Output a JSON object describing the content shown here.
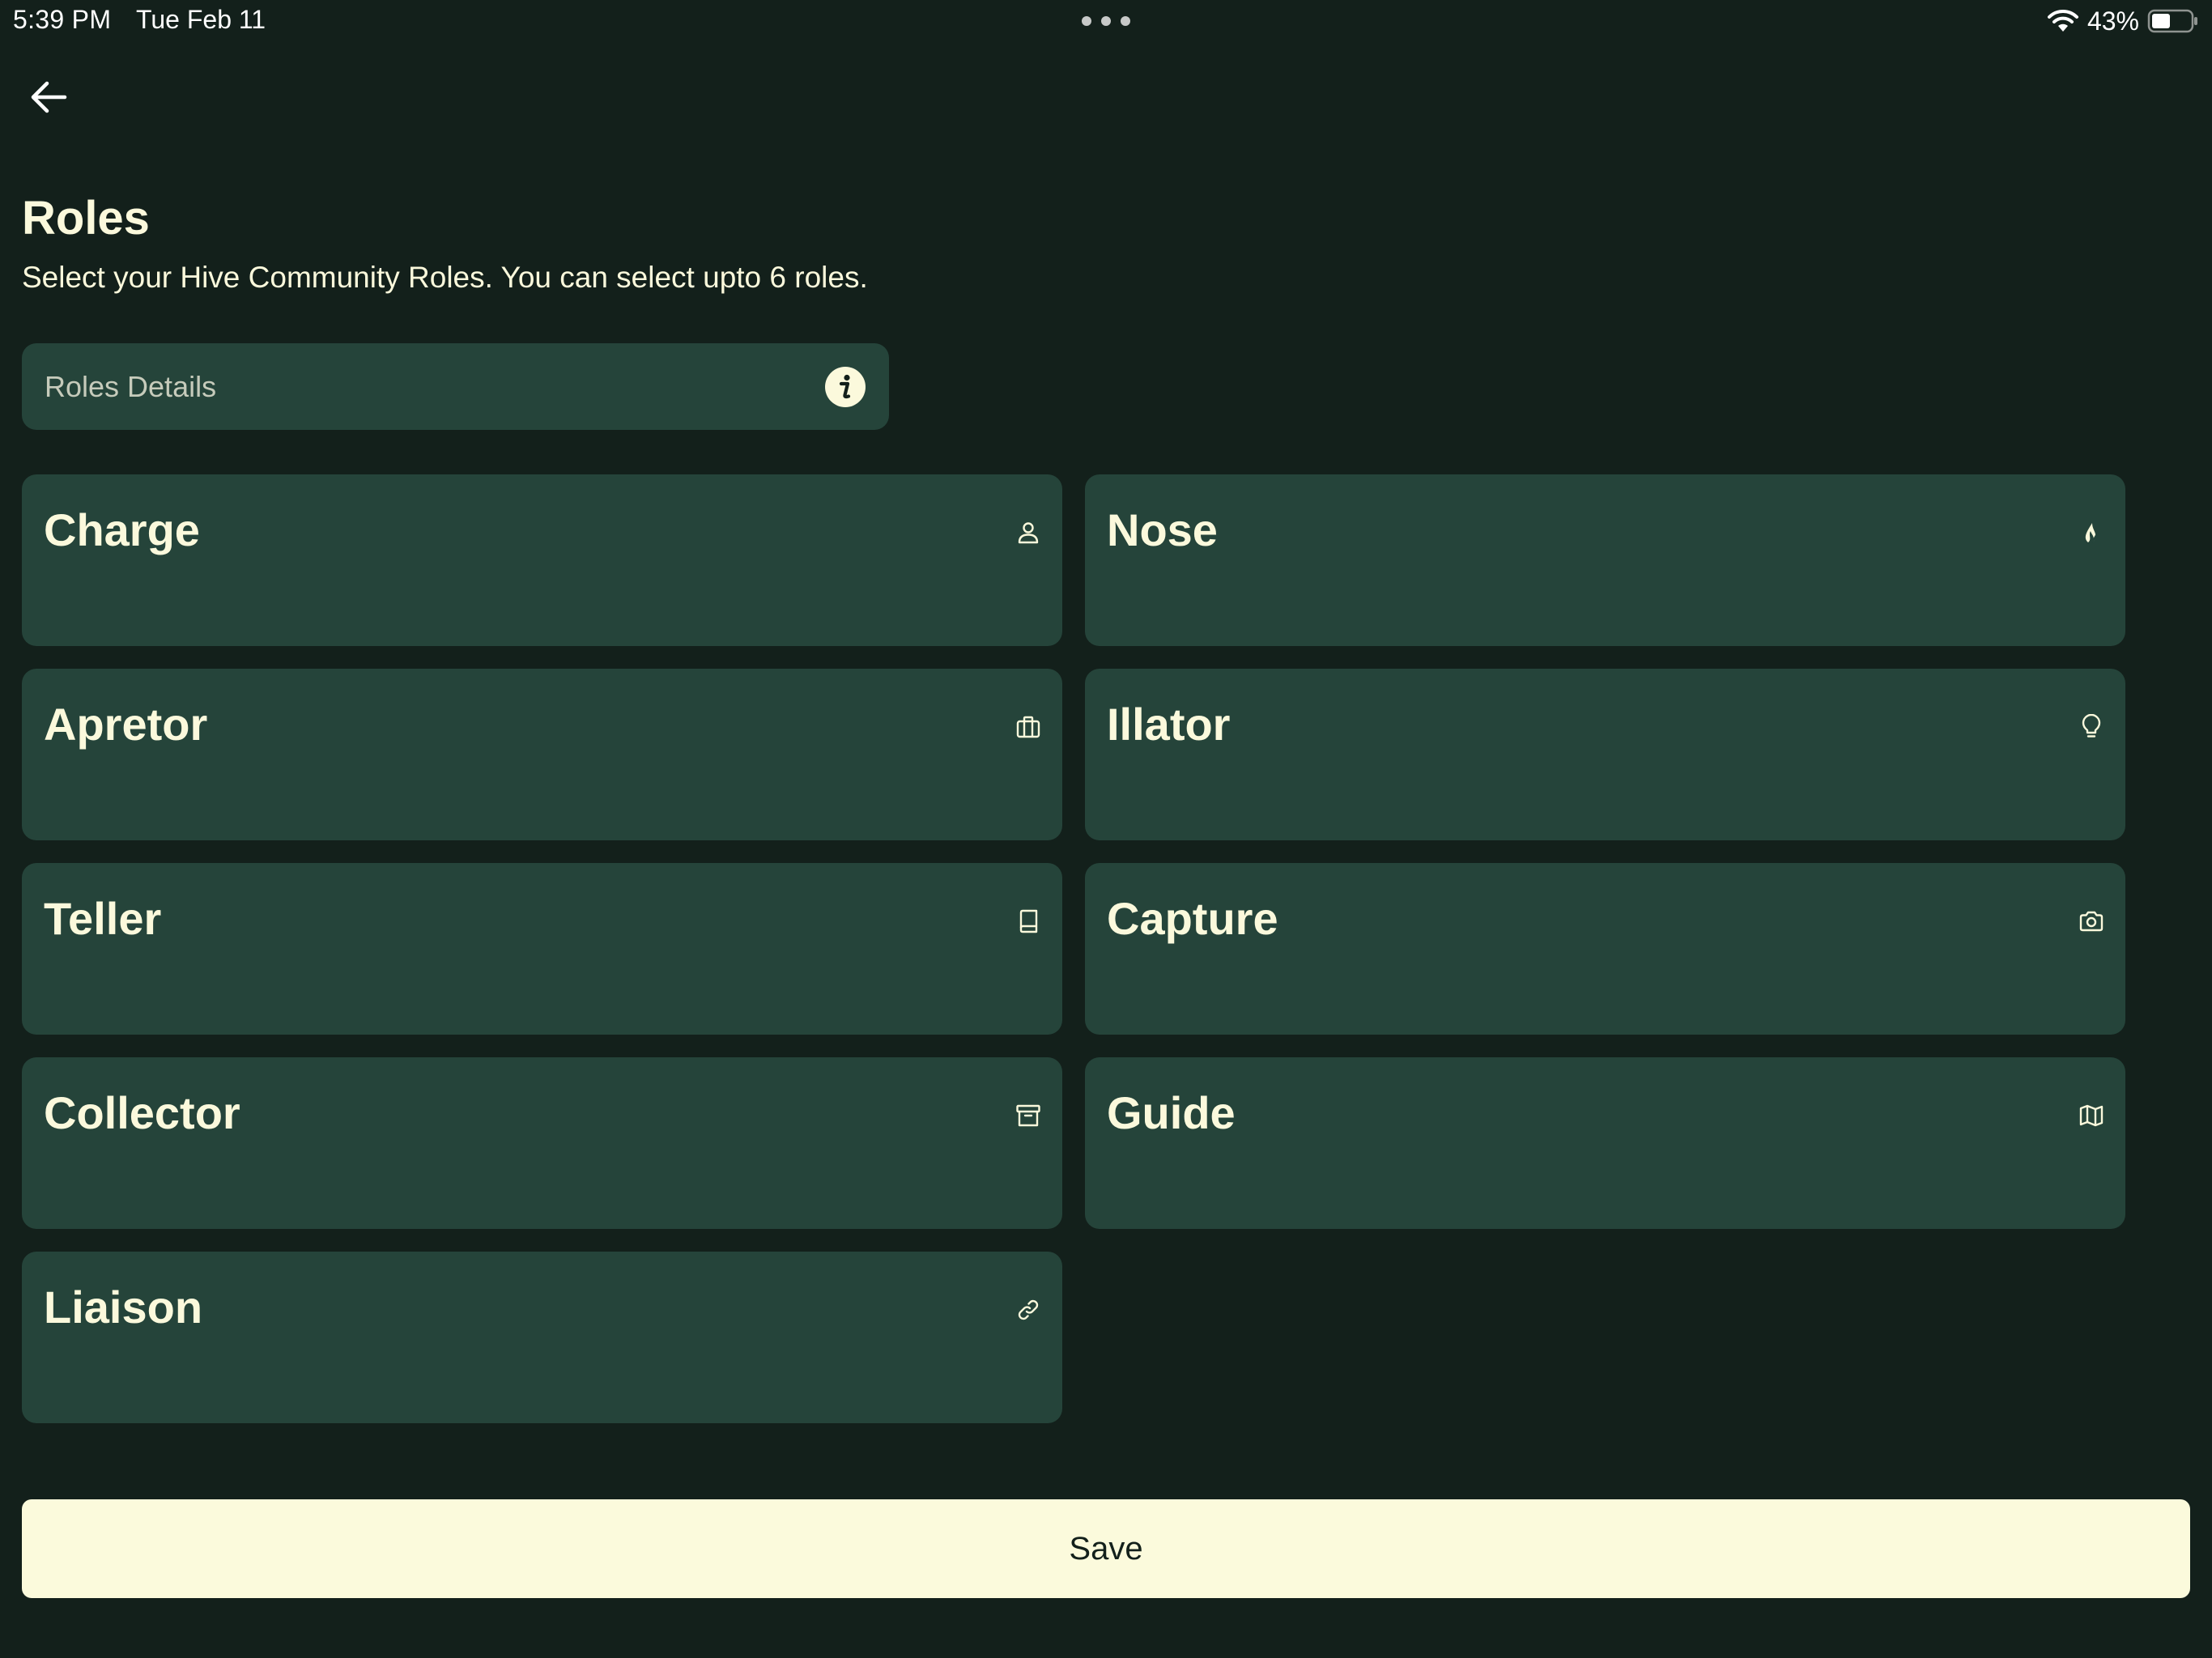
{
  "status_bar": {
    "time": "5:39 PM",
    "date": "Tue Feb 11",
    "battery": "43%"
  },
  "header": {
    "title": "Roles",
    "subtitle": "Select your Hive Community Roles. You can select upto 6 roles."
  },
  "details": {
    "label": "Roles Details"
  },
  "roles": [
    {
      "name": "Charge",
      "icon": "person-icon"
    },
    {
      "name": "Nose",
      "icon": "flame-icon"
    },
    {
      "name": "Apretor",
      "icon": "briefcase-icon"
    },
    {
      "name": "Illator",
      "icon": "lightbulb-icon"
    },
    {
      "name": "Teller",
      "icon": "book-icon"
    },
    {
      "name": "Capture",
      "icon": "camera-icon"
    },
    {
      "name": "Collector",
      "icon": "archive-icon"
    },
    {
      "name": "Guide",
      "icon": "map-icon"
    },
    {
      "name": "Liaison",
      "icon": "link-icon"
    }
  ],
  "actions": {
    "save_label": "Save"
  },
  "colors": {
    "background": "#13201b",
    "card": "#25443a",
    "text": "#fbf9dc",
    "button": "#fbfadc"
  }
}
